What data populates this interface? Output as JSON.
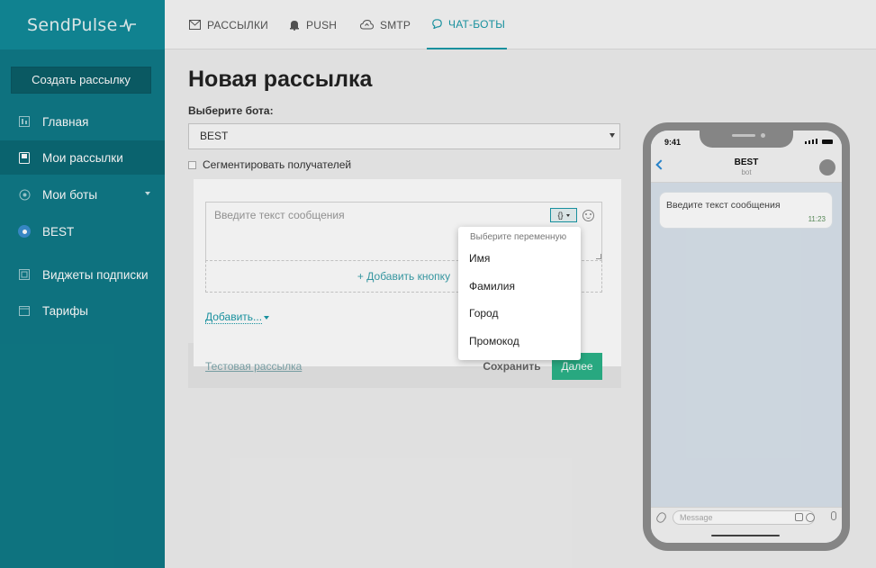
{
  "app": {
    "logo": "SendPulse"
  },
  "sidebar": {
    "create_button": "Создать рассылку",
    "items": [
      {
        "label": "Главная",
        "icon": "dashboard-icon"
      },
      {
        "label": "Мои рассылки",
        "icon": "campaigns-icon"
      },
      {
        "label": "Мои боты",
        "icon": "bots-icon"
      },
      {
        "label": "BEST",
        "icon": "bot-avatar"
      },
      {
        "label": "Виджеты подписки",
        "icon": "widget-icon"
      },
      {
        "label": "Тарифы",
        "icon": "pricing-icon"
      }
    ]
  },
  "topnav": {
    "tabs": [
      {
        "label": "РАССЫЛКИ",
        "icon": "mail-icon"
      },
      {
        "label": "PUSH",
        "icon": "bell-icon"
      },
      {
        "label": "SMTP",
        "icon": "cloud-icon"
      },
      {
        "label": "ЧАТ-БОТЫ",
        "icon": "chat-icon"
      }
    ],
    "active": "ЧАТ-БОТЫ"
  },
  "main": {
    "title": "Новая рассылка",
    "bot_label": "Выберите бота:",
    "bot_selected": "BEST",
    "segment_label": "Сегментировать получателей",
    "message_placeholder": "Введите текст сообщения",
    "variable_button": "{}",
    "add_button_label": "+ Добавить кнопку",
    "add_link": "Добавить...",
    "test_link": "Тестовая рассылка",
    "save_button": "Сохранить",
    "next_button": "Далее"
  },
  "dropdown": {
    "header": "Выберите переменную",
    "items": [
      "Имя",
      "Фамилия",
      "Город",
      "Промокод"
    ]
  },
  "phone": {
    "time": "9:41",
    "chat_title": "BEST",
    "chat_subtitle": "bot",
    "bubble_text": "Введите текст сообщения",
    "bubble_time": "11:23",
    "input_placeholder": "Message"
  },
  "colors": {
    "sidebar": "#0f7a87",
    "accent": "#1a9aa8",
    "next": "#2bb388"
  }
}
